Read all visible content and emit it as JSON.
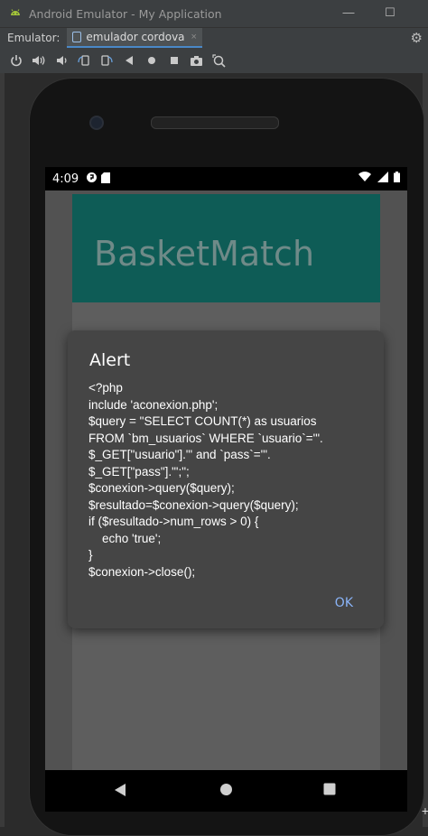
{
  "window": {
    "title": "Android Emulator - My Application",
    "app_icon": "android-icon",
    "minimize": "—",
    "maximize": "☐"
  },
  "tabbar": {
    "label": "Emulator:",
    "tab_label": "emulador cordova",
    "close_glyph": "×",
    "settings_glyph": "⚙"
  },
  "toolbar": {
    "icons": [
      "power-icon",
      "volume-up-icon",
      "volume-down-icon",
      "rotate-left-icon",
      "rotate-right-icon",
      "back-icon",
      "home-icon",
      "overview-icon",
      "screenshot-icon",
      "zoom-icon"
    ]
  },
  "device": {
    "status_bar": {
      "time": "4:09",
      "left_icons": [
        "data-saver-icon",
        "sd-card-icon"
      ],
      "right_icons": [
        "wifi-icon",
        "signal-icon",
        "battery-icon"
      ]
    },
    "app_title": "BasketMatch",
    "accent_color": "#0e5c56",
    "dialog": {
      "title": "Alert",
      "message": "<?php\ninclude 'aconexion.php';\n$query = \"SELECT COUNT(*) as usuarios\nFROM `bm_usuarios` WHERE `usuario`='\".\n$_GET[\"usuario\"].\"' and `pass`='\".\n$_GET[\"pass\"].\"';\";\n$conexion->query($query);\n$resultado=$conexion->query($query);\nif ($resultado->num_rows > 0) {\n    echo 'true';\n}\n$conexion->close();",
      "ok_label": "OK",
      "ok_color": "#8ab4f8"
    }
  }
}
